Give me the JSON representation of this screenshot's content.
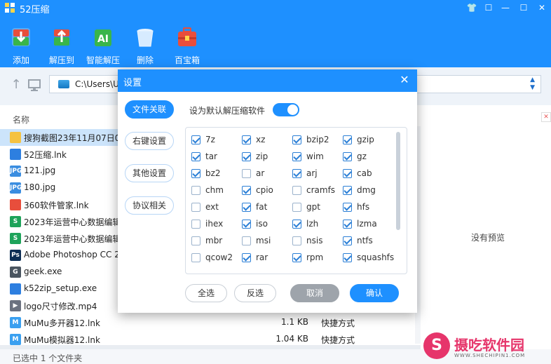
{
  "app": {
    "title": "52压缩"
  },
  "window_controls": {
    "skin": "👕",
    "feedback": "☐",
    "minimize": "—",
    "maximize": "☐",
    "close": "✕"
  },
  "toolbar": [
    {
      "label": "添加",
      "icon": "add-archive-icon"
    },
    {
      "label": "解压到",
      "icon": "extract-to-icon"
    },
    {
      "label": "智能解压",
      "icon": "ai-extract-icon"
    },
    {
      "label": "删除",
      "icon": "delete-icon"
    },
    {
      "label": "百宝箱",
      "icon": "toolbox-icon"
    }
  ],
  "address": {
    "path": "C:\\Users\\U"
  },
  "file_list": {
    "header_name": "名称",
    "rows": [
      {
        "name": "搜狗截图23年11月07日09",
        "size": "",
        "type": "",
        "icon": "folder-icon",
        "color": "#f5c242",
        "glyph": "",
        "selected": true
      },
      {
        "name": "52压缩.lnk",
        "size": "",
        "type": "",
        "icon": "app-52zip-icon",
        "color": "#2d7fe0",
        "glyph": "",
        "selected": false
      },
      {
        "name": "121.jpg",
        "size": "",
        "type": "",
        "icon": "jpg-file-icon",
        "color": "#3a8de0",
        "glyph": "JPG",
        "selected": false
      },
      {
        "name": "180.jpg",
        "size": "",
        "type": "",
        "icon": "jpg-file-icon",
        "color": "#3a8de0",
        "glyph": "JPG",
        "selected": false
      },
      {
        "name": "360软件管家.lnk",
        "size": "",
        "type": "",
        "icon": "app-360-icon",
        "color": "#e84e3c",
        "glyph": "",
        "selected": false
      },
      {
        "name": "2023年运营中心数据编辑",
        "size": "",
        "type": "",
        "icon": "spreadsheet-file-icon",
        "color": "#1ea35a",
        "glyph": "S",
        "selected": false
      },
      {
        "name": "2023年运营中心数据编辑",
        "size": "",
        "type": "",
        "icon": "spreadsheet-file-icon",
        "color": "#1ea35a",
        "glyph": "S",
        "selected": false
      },
      {
        "name": "Adobe Photoshop CC 2",
        "size": "",
        "type": "",
        "icon": "photoshop-icon",
        "color": "#0c2d54",
        "glyph": "Ps",
        "selected": false
      },
      {
        "name": "geek.exe",
        "size": "",
        "type": "",
        "icon": "geek-app-icon",
        "color": "#4a5560",
        "glyph": "G",
        "selected": false
      },
      {
        "name": "k52zip_setup.exe",
        "size": "",
        "type": "",
        "icon": "installer-icon",
        "color": "#2d7fe0",
        "glyph": "",
        "selected": false
      },
      {
        "name": "logo尺寸修改.mp4",
        "size": "",
        "type": "",
        "icon": "video-file-icon",
        "color": "#6b7280",
        "glyph": "▶",
        "selected": false
      },
      {
        "name": "MuMu多开器12.lnk",
        "size": "1.1 KB",
        "type": "快捷方式",
        "icon": "mumu-icon",
        "color": "#3aa0f0",
        "glyph": "M",
        "selected": false
      },
      {
        "name": "MuMu模拟器12.lnk",
        "size": "1.04 KB",
        "type": "快捷方式",
        "icon": "mumu-icon",
        "color": "#3aa0f0",
        "glyph": "M",
        "selected": false
      }
    ]
  },
  "preview": {
    "empty_text": "没有预览"
  },
  "status": {
    "text": "已选中 1 个文件夹"
  },
  "watermark": {
    "logo_letter": "S",
    "title": "摄吃软件园",
    "subtitle": "WWW.SHECHIPIN1.COM"
  },
  "dialog": {
    "title": "设置",
    "tabs": [
      {
        "label": "文件关联",
        "active": true
      },
      {
        "label": "右键设置",
        "active": false
      },
      {
        "label": "其他设置",
        "active": false
      },
      {
        "label": "协议相关",
        "active": false
      }
    ],
    "default_app_label": "设为默认解压缩软件",
    "default_app_enabled": true,
    "extensions": [
      [
        {
          "ext": "7z",
          "checked": true
        },
        {
          "ext": "xz",
          "checked": true
        },
        {
          "ext": "bzip2",
          "checked": true
        },
        {
          "ext": "gzip",
          "checked": true
        }
      ],
      [
        {
          "ext": "tar",
          "checked": true
        },
        {
          "ext": "zip",
          "checked": true
        },
        {
          "ext": "wim",
          "checked": true
        },
        {
          "ext": "gz",
          "checked": true
        }
      ],
      [
        {
          "ext": "bz2",
          "checked": true
        },
        {
          "ext": "ar",
          "checked": false
        },
        {
          "ext": "arj",
          "checked": true
        },
        {
          "ext": "cab",
          "checked": true
        }
      ],
      [
        {
          "ext": "chm",
          "checked": false
        },
        {
          "ext": "cpio",
          "checked": true
        },
        {
          "ext": "cramfs",
          "checked": false
        },
        {
          "ext": "dmg",
          "checked": true
        }
      ],
      [
        {
          "ext": "ext",
          "checked": false
        },
        {
          "ext": "fat",
          "checked": true
        },
        {
          "ext": "gpt",
          "checked": false
        },
        {
          "ext": "hfs",
          "checked": true
        }
      ],
      [
        {
          "ext": "ihex",
          "checked": false
        },
        {
          "ext": "iso",
          "checked": true
        },
        {
          "ext": "lzh",
          "checked": true
        },
        {
          "ext": "lzma",
          "checked": true
        }
      ],
      [
        {
          "ext": "mbr",
          "checked": false
        },
        {
          "ext": "msi",
          "checked": false
        },
        {
          "ext": "nsis",
          "checked": false
        },
        {
          "ext": "ntfs",
          "checked": true
        }
      ],
      [
        {
          "ext": "qcow2",
          "checked": false
        },
        {
          "ext": "rar",
          "checked": true
        },
        {
          "ext": "rpm",
          "checked": true
        },
        {
          "ext": "squashfs",
          "checked": true
        }
      ]
    ],
    "buttons": {
      "select_all": "全选",
      "invert": "反选",
      "cancel": "取消",
      "confirm": "确认"
    }
  },
  "colors": {
    "brand": "#1e90ff",
    "watermark": "#e6356b"
  }
}
